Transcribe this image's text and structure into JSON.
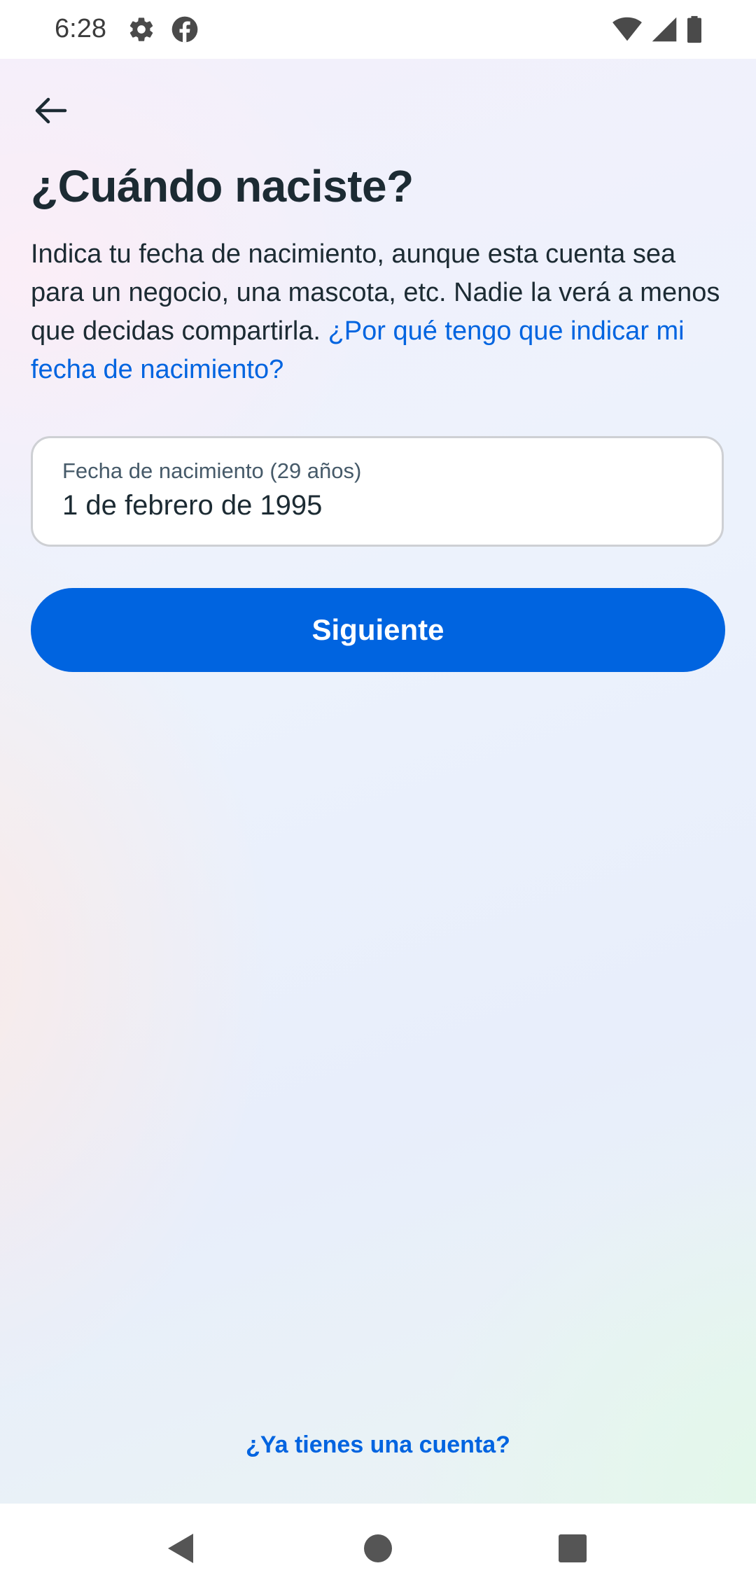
{
  "status_bar": {
    "time": "6:28",
    "left_icons": [
      "settings-icon",
      "facebook-icon"
    ],
    "right_icons": [
      "wifi-icon",
      "cellular-signal-icon",
      "battery-icon"
    ]
  },
  "header": {
    "back_icon": "arrow-left-icon"
  },
  "main": {
    "title": "¿Cuándo naciste?",
    "description": "Indica tu fecha de nacimiento, aunque esta cuenta sea para un negocio, una mascota, etc. Nadie la verá a menos que decidas compartirla.",
    "description_link": "¿Por qué tengo que indicar mi fecha de nacimiento?",
    "birthdate_field": {
      "label": "Fecha de nacimiento (29 años)",
      "value": "1 de febrero de 1995"
    },
    "next_button_label": "Siguiente"
  },
  "footer": {
    "have_account_link": "¿Ya tienes una cuenta?"
  },
  "nav_bar": {
    "icons": [
      "back-triangle-icon",
      "home-circle-icon",
      "recents-square-icon"
    ]
  },
  "colors": {
    "accent": "#0064e0",
    "text_primary": "#1c2b33",
    "text_secondary": "#465a69",
    "field_border": "#ced0d4"
  }
}
